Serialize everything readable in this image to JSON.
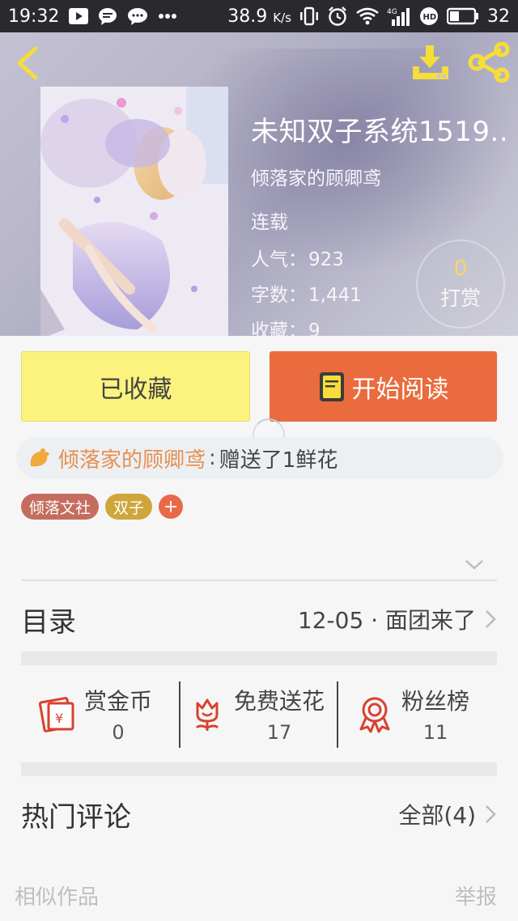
{
  "status_bar": {
    "time": "19:32",
    "net_speed": "38.9",
    "net_unit": "K/s",
    "battery": "32",
    "icons": [
      "video-play-icon",
      "message-bubble-icon",
      "wechat-icon",
      "more-dots-icon",
      "vibrate-icon",
      "alarm-icon",
      "wifi-icon",
      "signal-4g-icon",
      "hd-icon",
      "battery-icon"
    ]
  },
  "header": {
    "book_title": "未知双子系统1519..",
    "author": "倾落家的顾卿鸢",
    "status": "连载",
    "popularity_label": "人气：",
    "popularity_value": "923",
    "words_label": "字数：",
    "words_value": "1,441",
    "favorites_label": "收藏：",
    "favorites_value": "9",
    "reward_count": "0",
    "reward_label": "打赏"
  },
  "actions": {
    "collected_label": "已收藏",
    "read_label": "开始阅读"
  },
  "notice": {
    "user": "倾落家的顾卿鸢",
    "separator": ":",
    "text": "赠送了1鲜花"
  },
  "tags": [
    "倾落文社",
    "双子"
  ],
  "tag_add": "+",
  "catalog": {
    "title": "目录",
    "latest": "12-05 · 面团来了"
  },
  "stats": {
    "coins_label": "赏金币",
    "coins_value": "0",
    "flowers_label": "免费送花",
    "flowers_value": "17",
    "fans_label": "粉丝榜",
    "fans_value": "11"
  },
  "hot_comments": {
    "title": "热门评论",
    "all_label": "全部(4)"
  },
  "footer": {
    "similar": "相似作品",
    "report": "举报"
  },
  "colors": {
    "collect_button": "#fbf37e",
    "read_button": "#ea6b3d",
    "accent_orange": "#e58f52",
    "icon_red": "#d8412e"
  }
}
